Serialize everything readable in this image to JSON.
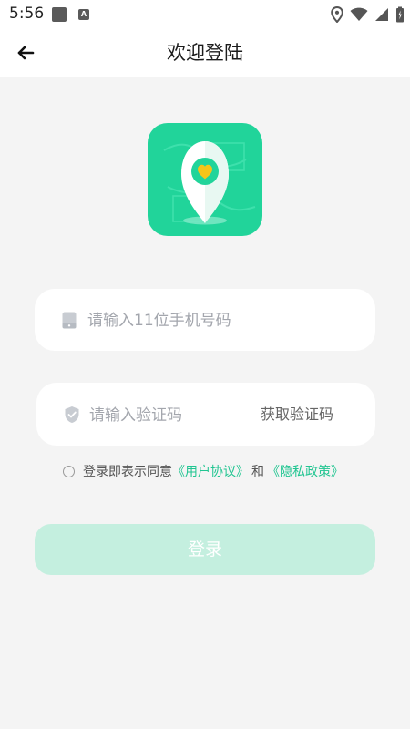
{
  "status_bar": {
    "time": "5:56",
    "notification_icon_letter": "A"
  },
  "header": {
    "title": "欢迎登陆",
    "back_icon": "arrow-left-icon"
  },
  "logo": {
    "icon": "location-pin-heart-icon",
    "colors": {
      "background": "#21d49a",
      "heart": "#f5c518"
    }
  },
  "phone_field": {
    "icon": "phone-icon",
    "placeholder": "请输入11位手机号码",
    "value": ""
  },
  "code_field": {
    "icon": "shield-check-icon",
    "placeholder": "请输入验证码",
    "value": "",
    "get_code_label": "获取验证码"
  },
  "agreement": {
    "prefix": "登录即表示同意",
    "user_agreement": "《用户协议》",
    "and": "和",
    "privacy_policy": "《隐私政策》",
    "checked": false
  },
  "login_button": {
    "label": "登录",
    "state": "disabled"
  },
  "colors": {
    "accent": "#21c591",
    "button_disabled": "#c4efdf",
    "page_background": "#f4f4f4"
  }
}
